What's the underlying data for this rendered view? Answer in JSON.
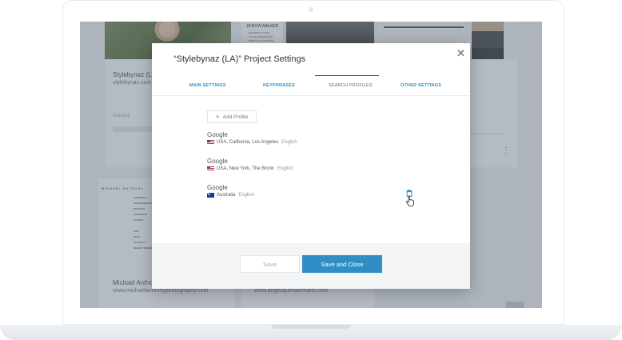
{
  "background": {
    "cards": [
      {
        "title": "Stylebynaz (LA)",
        "url": "stylebynaz.com",
        "engine_label": "GOOGLE",
        "percent": "0%"
      },
      {
        "thumb_name": "JA'NIYA WALKER",
        "thumb_line1": "FASHION STYLIST",
        "thumb_line2": "STYLE CONSULTANT",
        "thumb_line3": "PERSONAL SHOPPER"
      },
      {
        "menu_icon": "kebab-menu-icon"
      },
      {
        "title": "Michael Anthony",
        "url": "www.michaelanthonyphotography.com",
        "logo_text": "MICHAEL ANTHONY",
        "menu": [
          "WEDDINGS",
          "ENGAGEMENTS",
          "BOUDOIR",
          "PORTRAITS",
          "ALBUMS",
          "",
          "INFO",
          "BLOG",
          "CONTACT",
          "RECENT WEDDINGS"
        ]
      },
      {
        "url": "www.angeliquesalzmann.com"
      }
    ]
  },
  "modal": {
    "title": "“Stylebynaz (LA)” Project Settings",
    "close_icon": "close-icon",
    "tabs": [
      {
        "label": "MAIN SETTINGS",
        "active": false
      },
      {
        "label": "KEYPHRASES",
        "active": false
      },
      {
        "label": "SEARCH PROFILES",
        "active": true
      },
      {
        "label": "OTHER SETTINGS",
        "active": false
      }
    ],
    "add_profile_label": "Add Profile",
    "profiles": [
      {
        "engine": "Google",
        "flag": "us-flag-icon",
        "location": "USA, California, Los Angeles",
        "language": "English"
      },
      {
        "engine": "Google",
        "flag": "us-flag-icon",
        "location": "USA, New York, The Bronx",
        "language": "English"
      },
      {
        "engine": "Google",
        "flag": "au-flag-icon",
        "location": "Australia",
        "language": "English"
      }
    ],
    "save_label": "Save",
    "save_close_label": "Save and Close"
  },
  "colors": {
    "accent": "#2f8ec5",
    "overlay": "#4e5c6e"
  }
}
